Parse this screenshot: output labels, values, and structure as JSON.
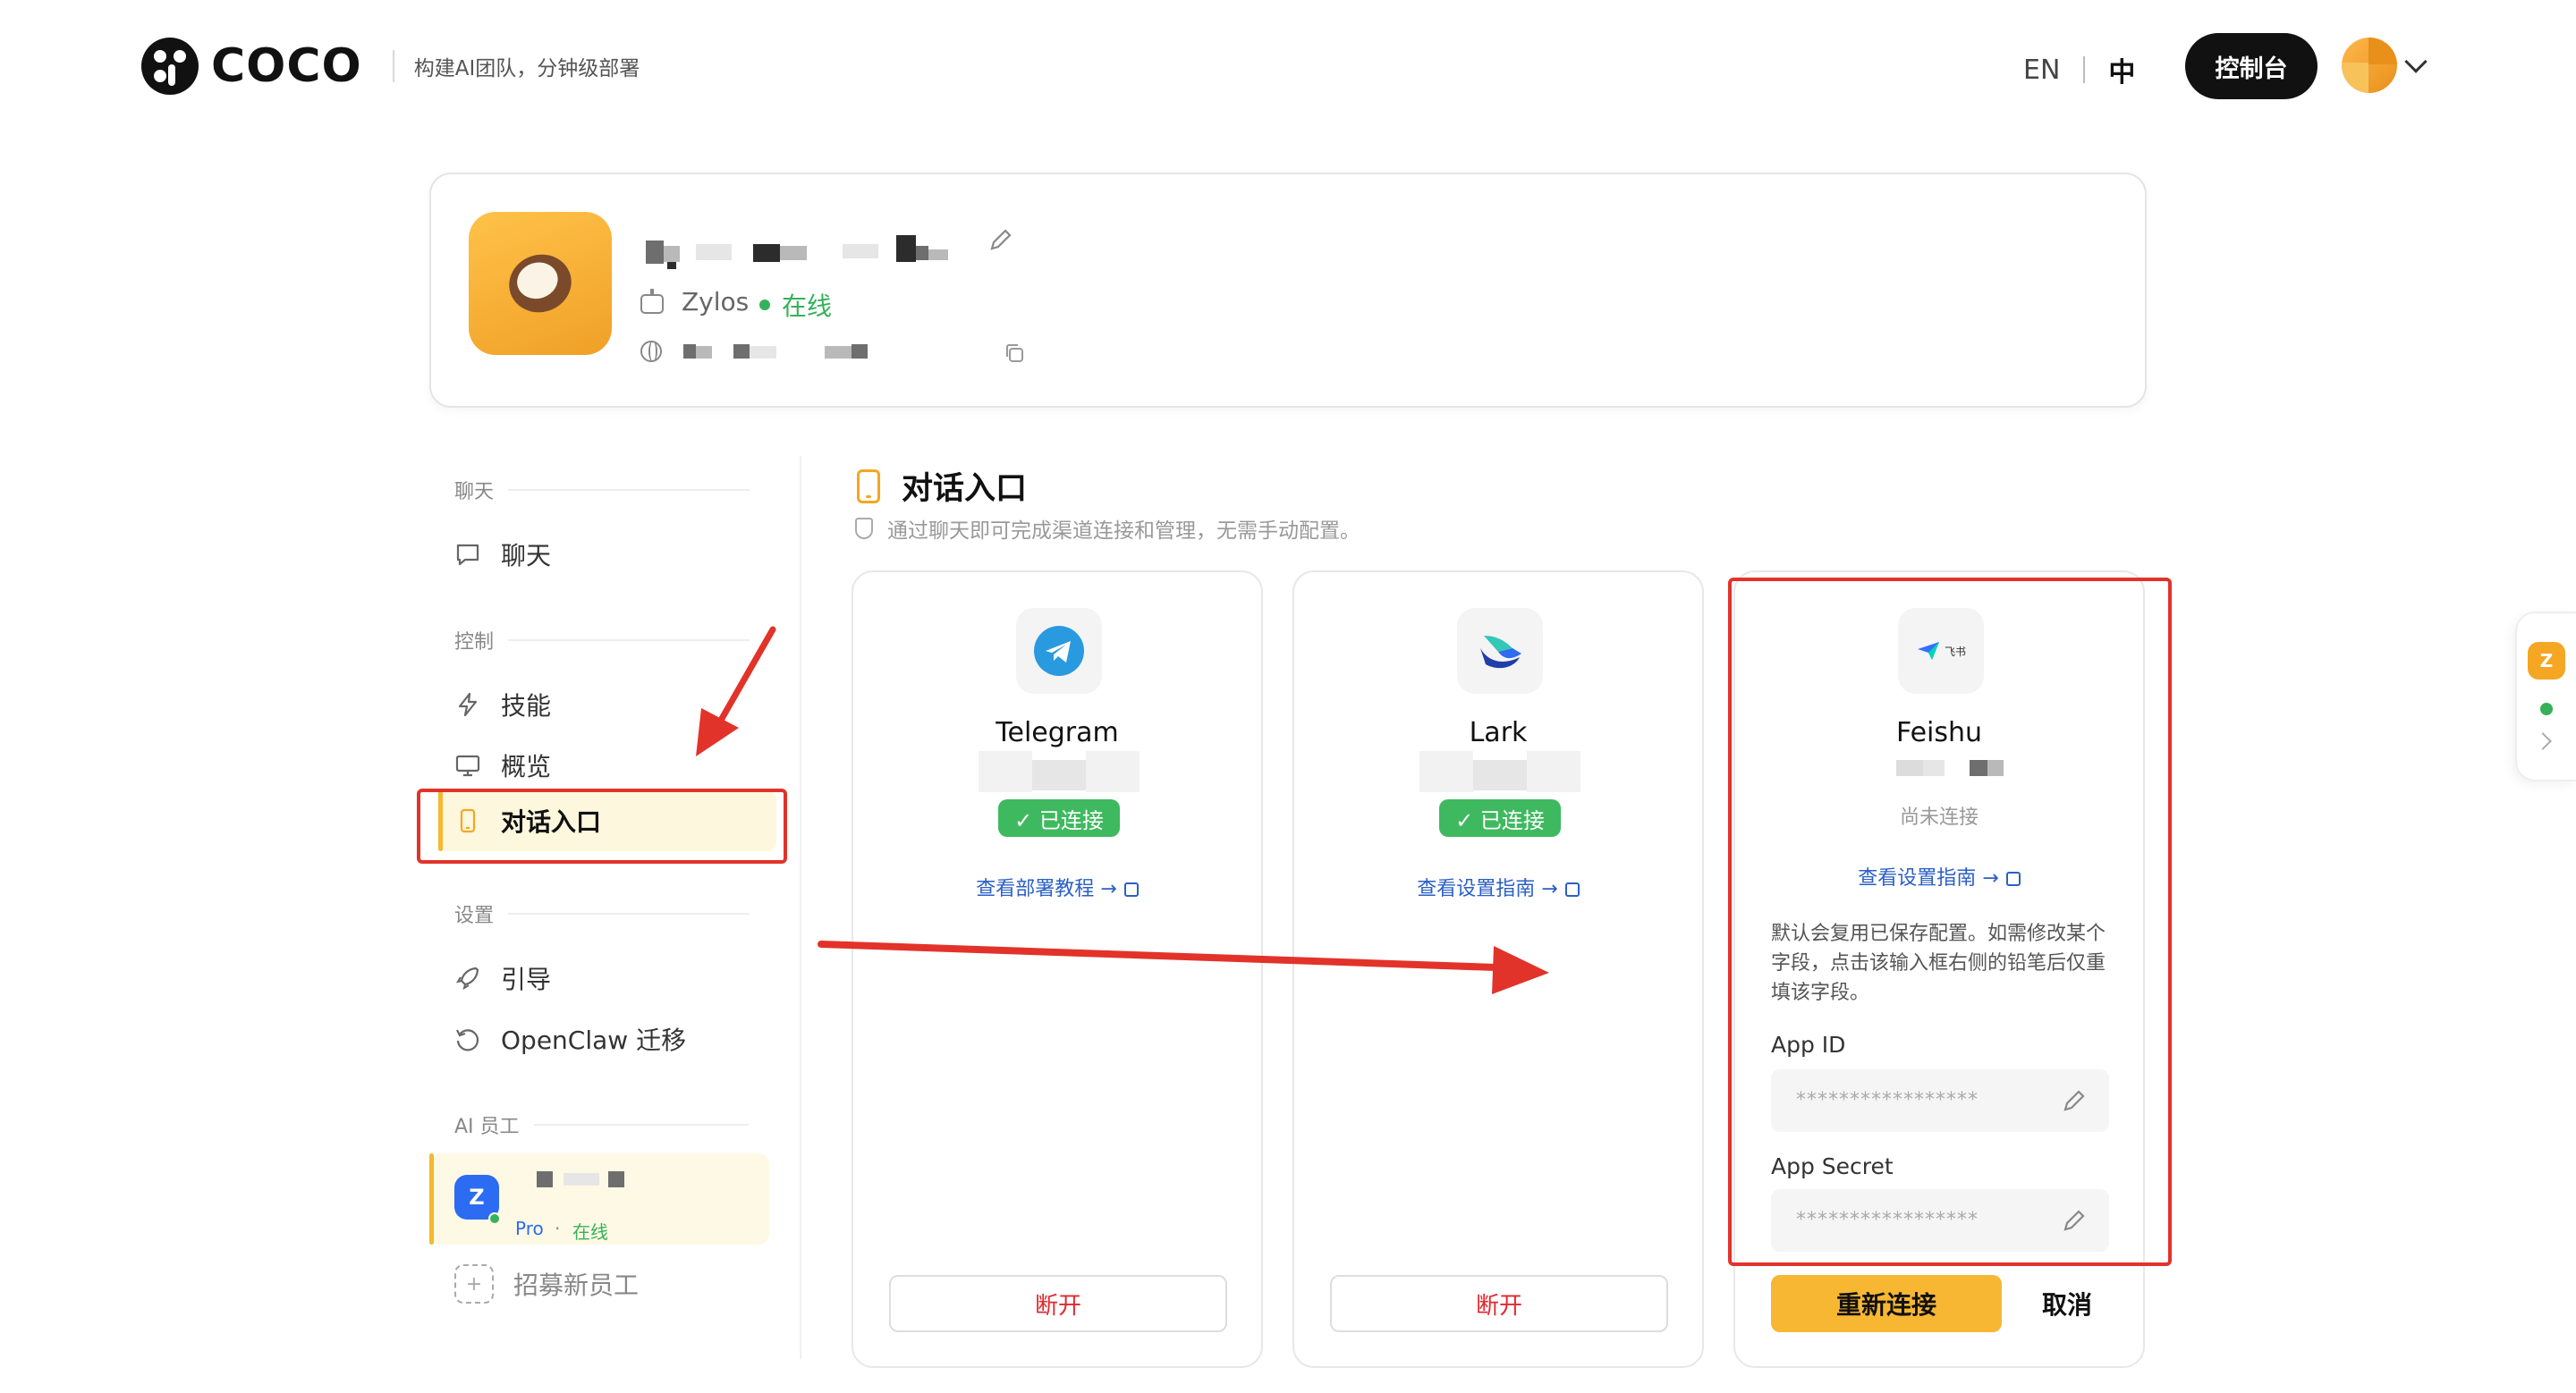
{
  "header": {
    "logo_text": "COCO",
    "tagline": "构建AI团队，分钟级部署",
    "lang_en": "EN",
    "lang_zh": "中",
    "console_button": "控制台"
  },
  "profile": {
    "model": "Zylos",
    "status": "在线"
  },
  "sidebar": {
    "sections": [
      {
        "title": "聊天",
        "items": [
          {
            "label": "聊天",
            "icon": "chat-bubble-icon"
          }
        ]
      },
      {
        "title": "控制",
        "items": [
          {
            "label": "技能",
            "icon": "lightning-icon"
          },
          {
            "label": "概览",
            "icon": "monitor-icon"
          },
          {
            "label": "对话入口",
            "icon": "phone-icon",
            "active": true
          }
        ]
      },
      {
        "title": "设置",
        "items": [
          {
            "label": "引导",
            "icon": "rocket-icon"
          },
          {
            "label": "OpenClaw 迁移",
            "icon": "history-icon"
          }
        ]
      },
      {
        "title": "AI 员工"
      }
    ],
    "employee": {
      "avatar_letter": "Z",
      "plan": "Pro",
      "separator": "·",
      "status": "在线"
    },
    "recruit_label": "招募新员工",
    "recruit_icon": "+"
  },
  "main": {
    "title": "对话入口",
    "subtitle": "通过聊天即可完成渠道连接和管理，无需手动配置。",
    "channels": [
      {
        "name": "Telegram",
        "badge": "✓ 已连接",
        "link": "查看部署教程 →",
        "button": "断开",
        "icon": "telegram-icon"
      },
      {
        "name": "Lark",
        "badge": "✓ 已连接",
        "link": "查看设置指南 →",
        "button": "断开",
        "icon": "lark-icon"
      },
      {
        "name": "Feishu",
        "status": "尚未连接",
        "link": "查看设置指南 →",
        "icon": "feishu-icon",
        "icon_text": "飞书",
        "note": "默认会复用已保存配置。如需修改某个字段，点击该输入框右侧的铅笔后仅重填该字段。",
        "fields": [
          {
            "label": "App ID",
            "placeholder": "*****************"
          },
          {
            "label": "App Secret",
            "placeholder": "*****************"
          }
        ],
        "reconnect_button": "重新连接",
        "cancel_button": "取消"
      }
    ]
  },
  "float_panel": {
    "badge": "Z",
    "chevron": "›"
  },
  "colors": {
    "accent": "#f5b82e",
    "online": "#35b15a",
    "link": "#2b5fc4",
    "danger": "#e0282f",
    "annotation": "#e2332a"
  }
}
